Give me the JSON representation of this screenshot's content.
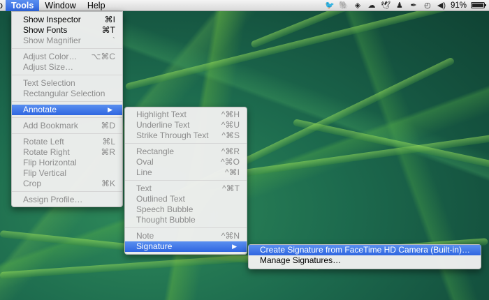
{
  "menubar": {
    "partial_item": "o",
    "items": [
      {
        "label": "Tools",
        "active": true
      },
      {
        "label": "Window",
        "active": false
      },
      {
        "label": "Help",
        "active": false
      }
    ],
    "status_icons": [
      "twitter-icon",
      "evernote-icon",
      "dropbox-icon",
      "creative-cloud-icon",
      "bird-icon",
      "person-icon",
      "pen-icon",
      "time-machine-icon",
      "volume-icon"
    ],
    "battery_text": "91%",
    "battery_level": 0.91
  },
  "tools_menu": {
    "items": [
      {
        "label": "Show Inspector",
        "shortcut": "⌘I",
        "disabled": false
      },
      {
        "label": "Show Fonts",
        "shortcut": "⌘T",
        "disabled": false
      },
      {
        "label": "Show Magnifier",
        "shortcut": "`",
        "disabled": true
      },
      {
        "sep": true
      },
      {
        "label": "Adjust Color…",
        "shortcut": "⌥⌘C",
        "disabled": true
      },
      {
        "label": "Adjust Size…",
        "shortcut": "",
        "disabled": true
      },
      {
        "sep": true
      },
      {
        "label": "Text Selection",
        "shortcut": "",
        "disabled": true
      },
      {
        "label": "Rectangular Selection",
        "shortcut": "",
        "disabled": true
      },
      {
        "sep": true
      },
      {
        "label": "Annotate",
        "shortcut": "",
        "disabled": false,
        "submenu": true,
        "highlight": true
      },
      {
        "sep": true
      },
      {
        "label": "Add Bookmark",
        "shortcut": "⌘D",
        "disabled": true
      },
      {
        "sep": true
      },
      {
        "label": "Rotate Left",
        "shortcut": "⌘L",
        "disabled": true
      },
      {
        "label": "Rotate Right",
        "shortcut": "⌘R",
        "disabled": true
      },
      {
        "label": "Flip Horizontal",
        "shortcut": "",
        "disabled": true
      },
      {
        "label": "Flip Vertical",
        "shortcut": "",
        "disabled": true
      },
      {
        "label": "Crop",
        "shortcut": "⌘K",
        "disabled": true
      },
      {
        "sep": true
      },
      {
        "label": "Assign Profile…",
        "shortcut": "",
        "disabled": true
      }
    ]
  },
  "annotate_menu": {
    "items": [
      {
        "label": "Highlight Text",
        "shortcut": "^⌘H",
        "disabled": true
      },
      {
        "label": "Underline Text",
        "shortcut": "^⌘U",
        "disabled": true
      },
      {
        "label": "Strike Through Text",
        "shortcut": "^⌘S",
        "disabled": true
      },
      {
        "sep": true
      },
      {
        "label": "Rectangle",
        "shortcut": "^⌘R",
        "disabled": true
      },
      {
        "label": "Oval",
        "shortcut": "^⌘O",
        "disabled": true
      },
      {
        "label": "Line",
        "shortcut": "^⌘I",
        "disabled": true
      },
      {
        "sep": true
      },
      {
        "label": "Text",
        "shortcut": "^⌘T",
        "disabled": true
      },
      {
        "label": "Outlined Text",
        "shortcut": "",
        "disabled": true
      },
      {
        "label": "Speech Bubble",
        "shortcut": "",
        "disabled": true
      },
      {
        "label": "Thought Bubble",
        "shortcut": "",
        "disabled": true
      },
      {
        "sep": true
      },
      {
        "label": "Note",
        "shortcut": "^⌘N",
        "disabled": true
      },
      {
        "label": "Signature",
        "shortcut": "",
        "disabled": false,
        "submenu": true,
        "highlight": true
      }
    ]
  },
  "signature_menu": {
    "items": [
      {
        "label": "Create Signature from FaceTime HD Camera (Built-in)…",
        "disabled": false,
        "highlight": true
      },
      {
        "label": "Manage Signatures…",
        "disabled": false,
        "highlight": false
      }
    ]
  },
  "colors": {
    "highlight": "#2f66e0",
    "disabled_text": "#8c8c8c",
    "wallpaper": "#1d6b4e"
  }
}
